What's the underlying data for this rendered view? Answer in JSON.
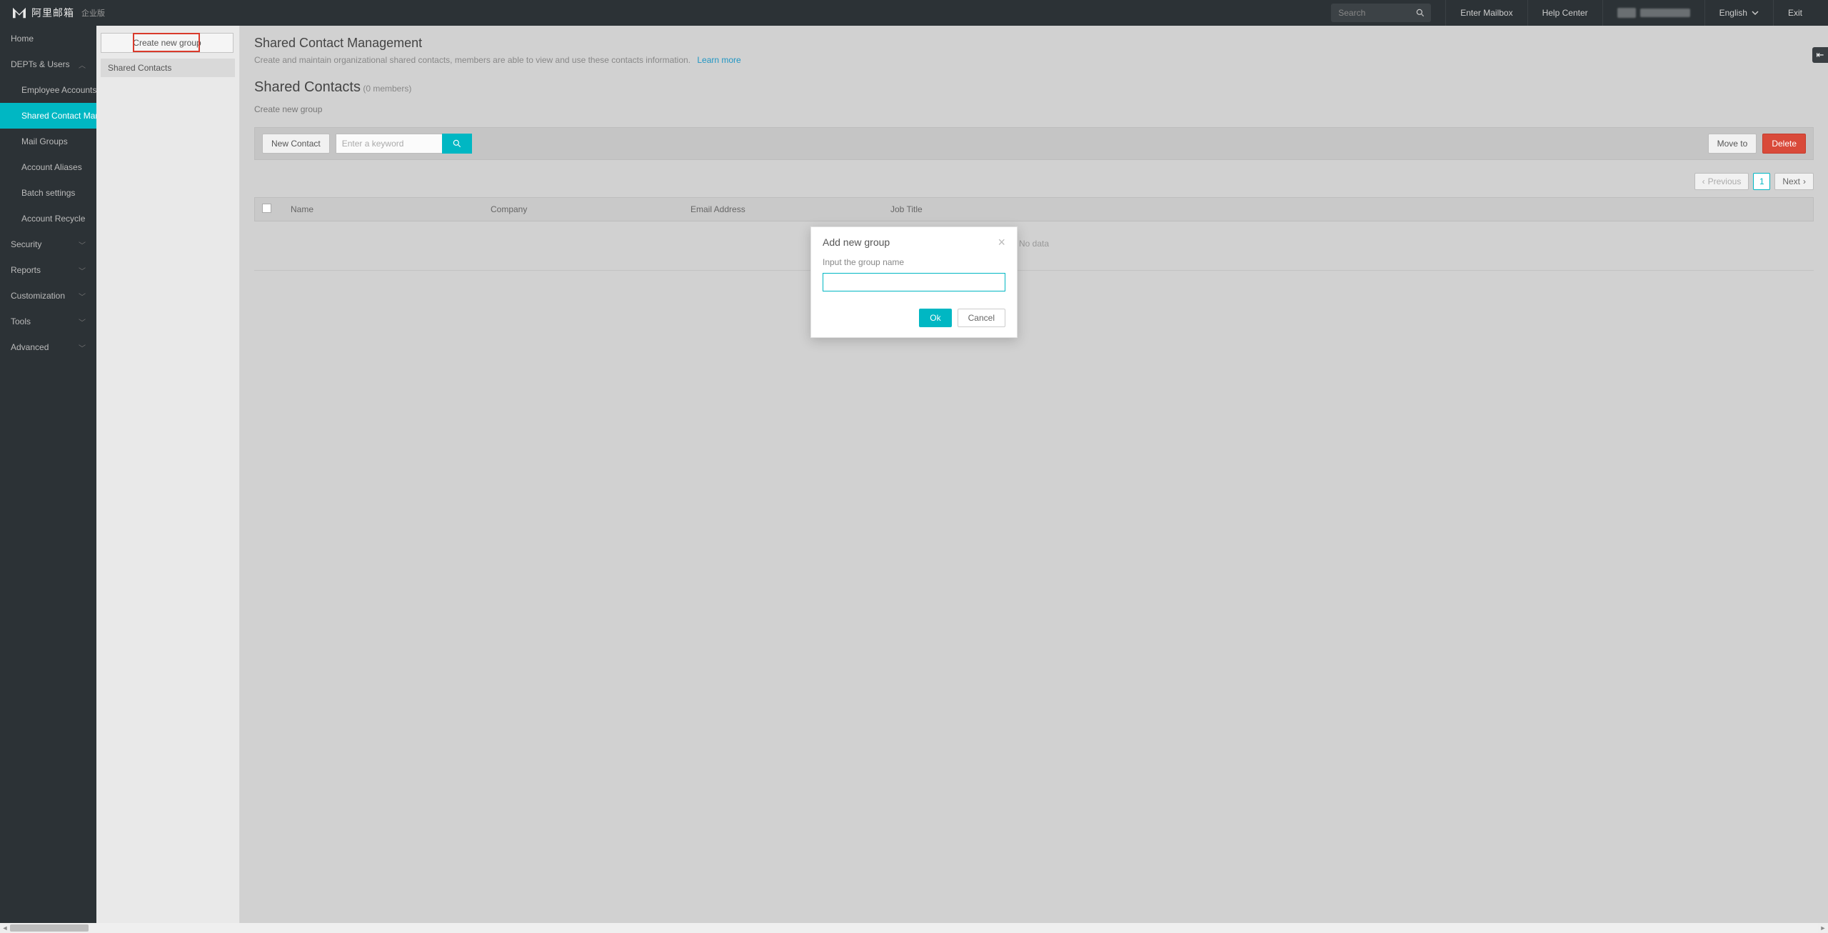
{
  "topbar": {
    "logo_text": "阿里邮箱",
    "logo_sub": "企业版",
    "search_placeholder": "Search",
    "enter_mailbox": "Enter Mailbox",
    "help_center": "Help Center",
    "language": "English",
    "exit": "Exit"
  },
  "sidebar": {
    "home": "Home",
    "depts": "DEPTs & Users",
    "depts_children": {
      "employee_accounts": "Employee Accounts",
      "shared_contact_mgmt": "Shared Contact Management",
      "mail_groups": "Mail Groups",
      "account_aliases": "Account Aliases",
      "batch_settings": "Batch settings",
      "account_recycle": "Account Recycle"
    },
    "security": "Security",
    "reports": "Reports",
    "customization": "Customization",
    "tools": "Tools",
    "advanced": "Advanced"
  },
  "second_col": {
    "create_group": "Create new group",
    "shared_contacts": "Shared Contacts"
  },
  "main": {
    "page_title": "Shared Contact Management",
    "page_desc": "Create and maintain organizational shared contacts, members are able to view and use these contacts information.",
    "learn_more": "Learn more",
    "contacts_title": "Shared Contacts",
    "contacts_sub": "(0 members)",
    "breadcrumb": "Create new group",
    "new_contact": "New Contact",
    "keyword_placeholder": "Enter a keyword",
    "move_to": "Move to",
    "delete": "Delete",
    "pager_prev": "Previous",
    "pager_page": "1",
    "pager_next": "Next",
    "th_name": "Name",
    "th_company": "Company",
    "th_email": "Email Address",
    "th_job": "Job Title",
    "no_data": "No data"
  },
  "modal": {
    "title": "Add new group",
    "label": "Input the group name",
    "ok": "Ok",
    "cancel": "Cancel"
  }
}
